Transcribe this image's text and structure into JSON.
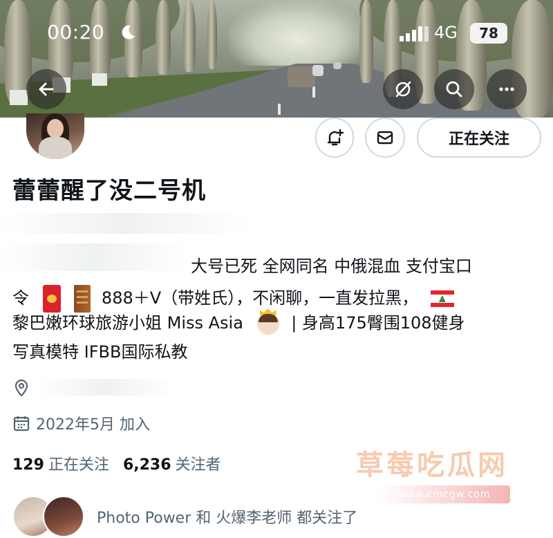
{
  "status_bar": {
    "time": "00:20",
    "network": "4G",
    "battery": "78",
    "moon_icon": "moon-icon",
    "signal_icon": "signal-icon"
  },
  "banner_actions": {
    "back_icon": "back-arrow-icon",
    "grok_icon": "grok-icon",
    "search_icon": "search-icon",
    "more_icon": "more-icon"
  },
  "profile": {
    "name": "蕾蕾醒了没二号机",
    "follow_label": "正在关注",
    "notify_icon": "bell-plus-icon",
    "message_icon": "mail-icon",
    "bio": {
      "line1": "大号已死 全网同名 中俄混血 支付宝口",
      "line2_prefix": "令",
      "line2_suffix": "888＋V（带姓氏），不闲聊，一直发拉黑，",
      "line3_prefix": "黎巴嫩环球旅游小姐 Miss Asia",
      "line3_suffix": "| 身高175臀围108健身",
      "line4": "写真模特 IFBB国际私教"
    },
    "location_icon": "location-pin-icon",
    "joined_icon": "calendar-icon",
    "joined": "2022年5月 加入",
    "following_count": "129",
    "following_label": "正在关注",
    "followers_count": "6,236",
    "followers_label": "关注者",
    "followed_by": "Photo Power 和 火爆李老师 都关注了"
  },
  "watermark": {
    "text": "草莓吃瓜网",
    "url": "www.cmcgw.com"
  },
  "colors": {
    "text_primary": "#0f1419",
    "text_secondary": "#536471",
    "border": "#cfd9de"
  }
}
